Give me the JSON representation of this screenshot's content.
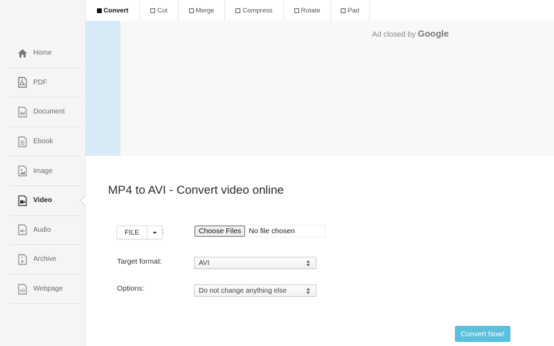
{
  "sidebar": {
    "items": [
      {
        "label": "Home",
        "icon": "home-icon"
      },
      {
        "label": "PDF",
        "icon": "pdf-icon"
      },
      {
        "label": "Document",
        "icon": "document-icon"
      },
      {
        "label": "Ebook",
        "icon": "ebook-icon"
      },
      {
        "label": "Image",
        "icon": "image-icon"
      },
      {
        "label": "Video",
        "icon": "video-icon",
        "active": true
      },
      {
        "label": "Audio",
        "icon": "audio-icon"
      },
      {
        "label": "Archive",
        "icon": "archive-icon"
      },
      {
        "label": "Webpage",
        "icon": "webpage-icon"
      }
    ]
  },
  "tabs": [
    {
      "label": "Convert",
      "active": true
    },
    {
      "label": "Cut"
    },
    {
      "label": "Merge"
    },
    {
      "label": "Compress"
    },
    {
      "label": "Rotate"
    },
    {
      "label": "Pad"
    }
  ],
  "ad": {
    "text": "Ad closed by",
    "brand": "Google"
  },
  "main": {
    "title": "MP4 to AVI - Convert video online",
    "file_button": "FILE",
    "colon": ":",
    "choose_files": "Choose Files",
    "no_file": "No file chosen",
    "target_format_label": "Target format:",
    "target_format_value": "AVI",
    "options_label": "Options:",
    "options_value": "Do not change anything else",
    "convert_button": "Convert Now!"
  },
  "colors": {
    "accent": "#5bc0de",
    "ad_strip": "#d7eaf5",
    "sidebar_bg": "#f5f5f5"
  }
}
